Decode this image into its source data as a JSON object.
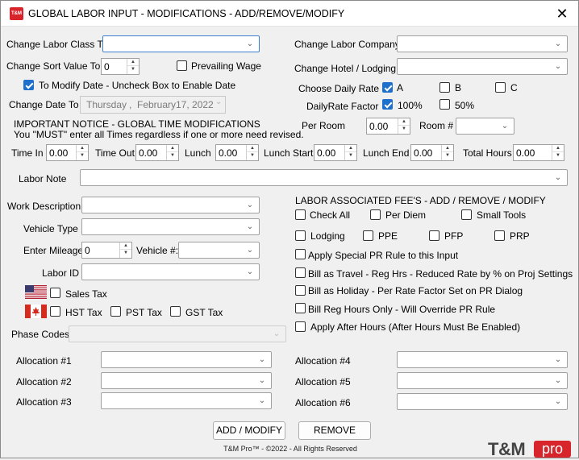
{
  "window": {
    "logo_text": "T&M",
    "title": "GLOBAL LABOR INPUT - MODIFICATIONS - ADD/REMOVE/MODIFY",
    "close_glyph": "✕"
  },
  "left": {
    "change_labor_class_label": "Change Labor Class To",
    "change_labor_class_value": "",
    "change_sort_label": "Change Sort Value To",
    "change_sort_value": "0",
    "prevailing_wage_label": "Prevailing Wage",
    "prevailing_wage_checked": false,
    "modify_date_label": "To Modify Date  - Uncheck Box to Enable Date",
    "modify_date_checked": true,
    "change_date_label": "Change Date To",
    "date_weekday": "Thursday",
    "date_comma": ",",
    "date_month": "February",
    "date_day": "17, 2022",
    "notice_line1": "IMPORTANT NOTICE - GLOBAL TIME MODIFICATIONS",
    "notice_line2": "You \"MUST\" enter all Times regardless if one or more need revised."
  },
  "right": {
    "change_labor_company_label": "Change Labor Company",
    "change_hotel_label": "Change Hotel / Lodging",
    "choose_daily_rate_label": "Choose Daily Rate",
    "rate_a_label": "A",
    "rate_a_checked": true,
    "rate_b_label": "B",
    "rate_b_checked": false,
    "rate_c_label": "C",
    "rate_c_checked": false,
    "daily_rate_factor_label": "DailyRate Factor",
    "factor_100_label": "100%",
    "factor_100_checked": true,
    "factor_50_label": "50%",
    "factor_50_checked": false,
    "per_room_label": "Per Room",
    "per_room_value": "0.00",
    "room_no_label": "Room #"
  },
  "times": {
    "time_in_label": "Time In",
    "time_in_value": "0.00",
    "time_out_label": "Time Out",
    "time_out_value": "0.00",
    "lunch_label": "Lunch",
    "lunch_value": "0.00",
    "lunch_start_label": "Lunch Start",
    "lunch_start_value": "0.00",
    "lunch_end_label": "Lunch End",
    "lunch_end_value": "0.00",
    "total_hours_label": "Total Hours",
    "total_hours_value": "0.00"
  },
  "labor_note_label": "Labor Note",
  "work": {
    "work_description_label": "Work Description",
    "vehicle_type_label": "Vehicle Type",
    "enter_mileage_label": "Enter Mileage",
    "mileage_value": "0",
    "vehicle_no_label": "Vehicle #:",
    "labor_id_label": "Labor ID",
    "sales_tax_label": "Sales Tax",
    "hst_tax_label": "HST Tax",
    "pst_tax_label": "PST Tax",
    "gst_tax_label": "GST Tax",
    "phase_codes_label": "Phase Codes"
  },
  "fees": {
    "header": "LABOR ASSOCIATED FEE'S - ADD / REMOVE / MODIFY",
    "check_all": "Check All",
    "per_diem": "Per Diem",
    "small_tools": "Small Tools",
    "lodging": "Lodging",
    "ppe": "PPE",
    "pfp": "PFP",
    "prp": "PRP",
    "apply_special_pr": "Apply Special PR Rule to this Input",
    "bill_travel": "Bill as Travel - Reg Hrs - Reduced Rate by % on Proj Settings",
    "bill_holiday": "Bill as Holiday - Per Rate Factor Set on PR Dialog",
    "bill_reg_hours": "Bill Reg Hours Only - Will Override PR Rule",
    "apply_after_hours": "Apply After Hours (After Hours Must Be Enabled)"
  },
  "allocations": {
    "a1": "Allocation #1",
    "a2": "Allocation #2",
    "a3": "Allocation #3",
    "a4": "Allocation #4",
    "a5": "Allocation #5",
    "a6": "Allocation #6"
  },
  "buttons": {
    "add_modify": "ADD / MODIFY",
    "remove": "REMOVE"
  },
  "footer": "T&M Pro™ - ©2022 - All Rights Reserved",
  "brand": {
    "tm": "T&M",
    "pro": "pro"
  },
  "icons": {
    "chevron": "⌄",
    "spin_up": "▲",
    "spin_down": "▼"
  },
  "colors": {
    "accent": "#1f6fcc",
    "brand_red": "#d8242b",
    "focus_border": "#3c7fd0"
  }
}
